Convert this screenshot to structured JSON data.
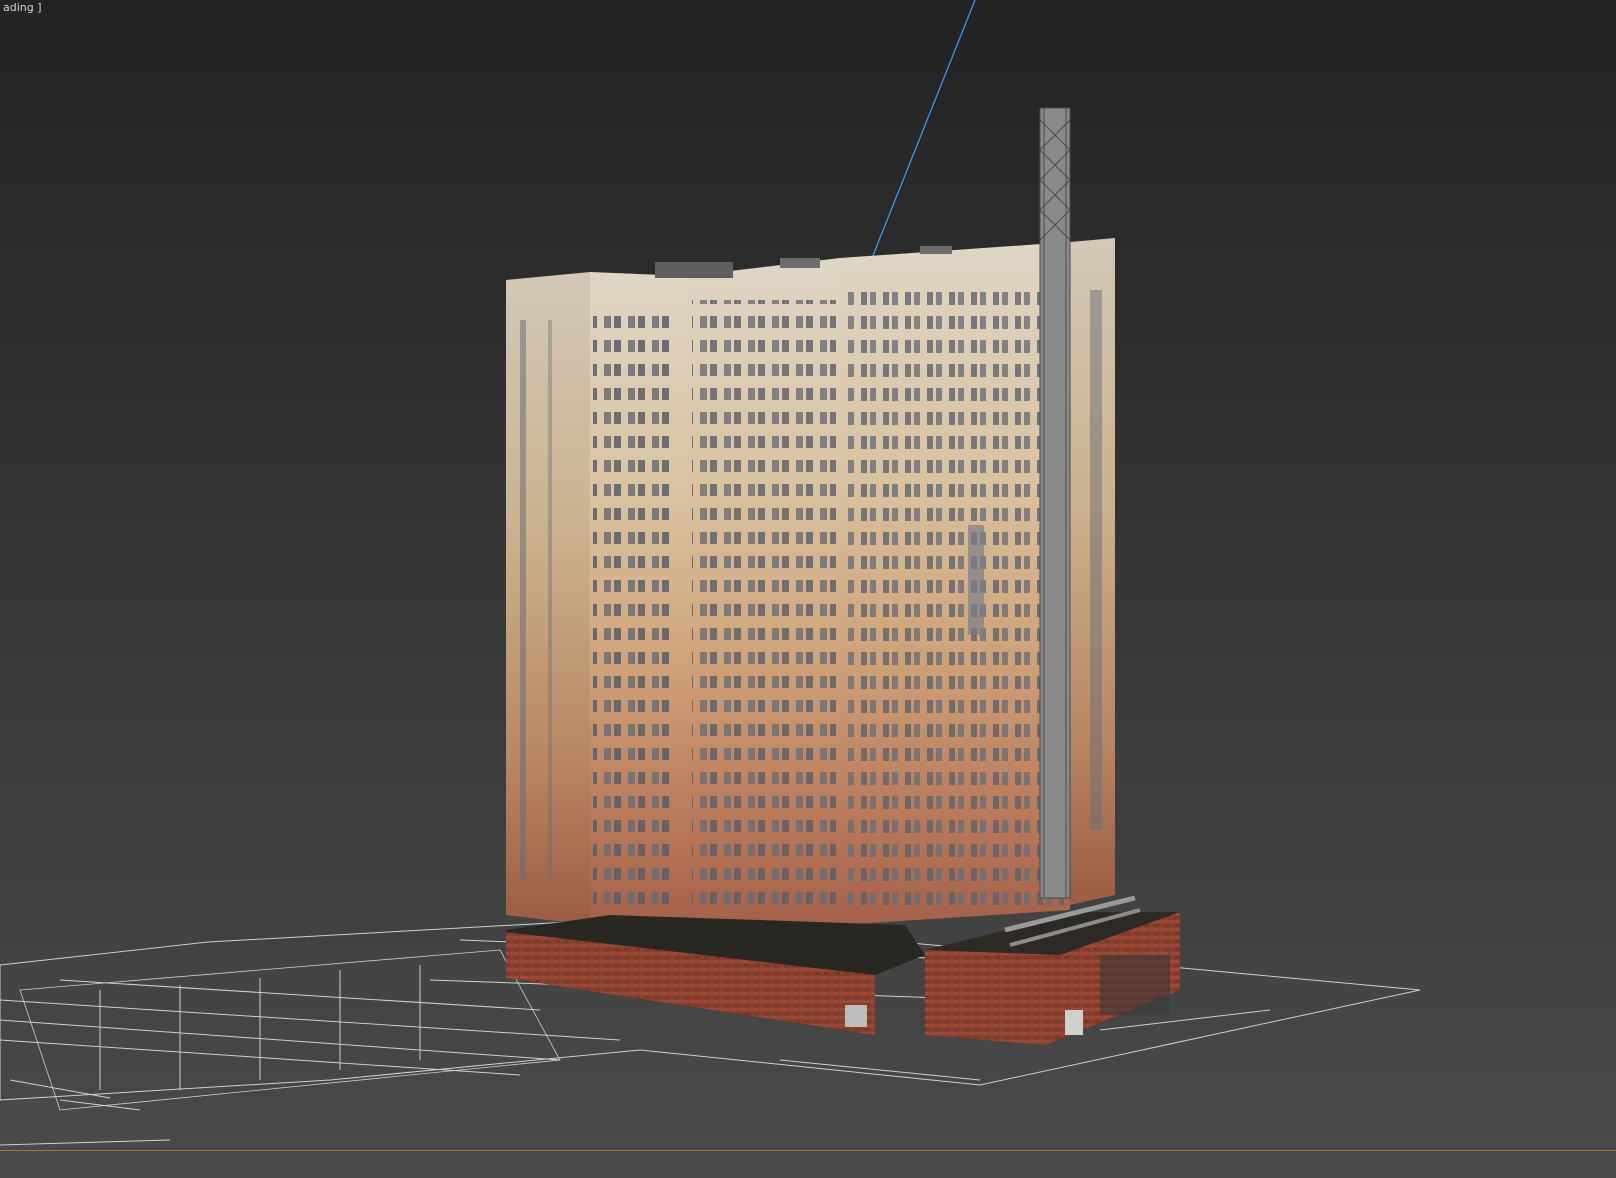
{
  "viewport": {
    "label": "ading ]",
    "accent_line_color": "#b08a2a",
    "gizmo_axis_color": "#3aa0ff"
  },
  "scene": {
    "object": "3d-residential-tower-model",
    "ground": "cad-site-plan-linework"
  }
}
